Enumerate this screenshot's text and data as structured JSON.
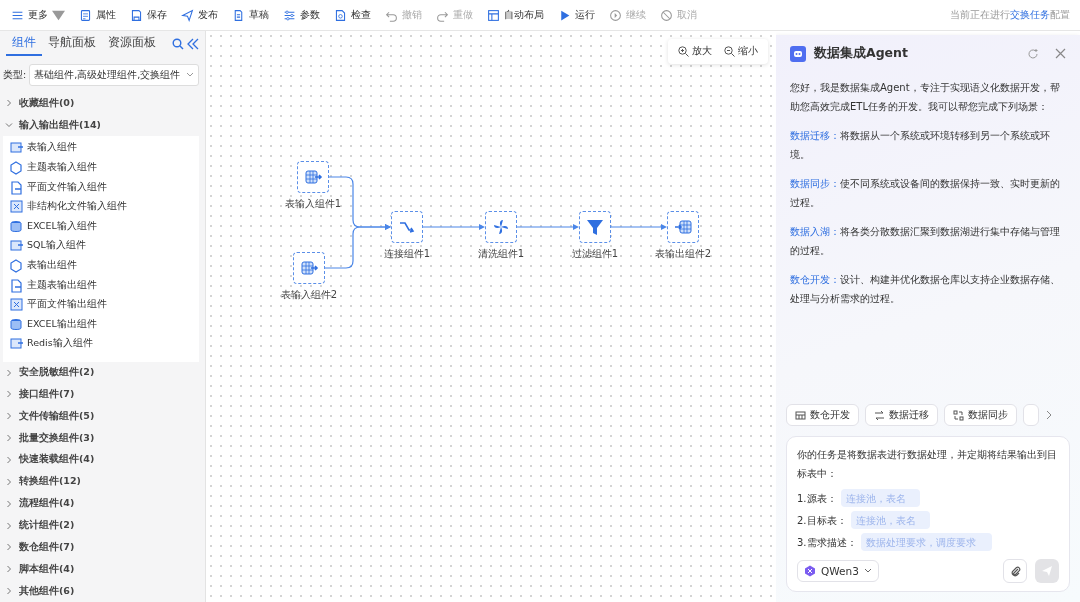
{
  "toolbar": {
    "items": [
      {
        "kind": "menu",
        "label": "更多",
        "disabled": false
      },
      {
        "kind": "button",
        "label": "属性",
        "disabled": false
      },
      {
        "kind": "button",
        "label": "保存",
        "disabled": false
      },
      {
        "kind": "button",
        "label": "发布",
        "disabled": false
      },
      {
        "kind": "button",
        "label": "草稿",
        "disabled": false
      },
      {
        "kind": "button",
        "label": "参数",
        "disabled": false
      },
      {
        "kind": "button",
        "label": "检查",
        "disabled": false
      },
      {
        "kind": "button",
        "label": "撤销",
        "disabled": true
      },
      {
        "kind": "button",
        "label": "重做",
        "disabled": true
      },
      {
        "kind": "button",
        "label": "自动布局",
        "disabled": false
      },
      {
        "kind": "button",
        "label": "运行",
        "disabled": false
      },
      {
        "kind": "button",
        "label": "继续",
        "disabled": true
      },
      {
        "kind": "button",
        "label": "取消",
        "disabled": true
      }
    ],
    "status": {
      "before": "当前正在进行",
      "link": "交换任务",
      "after": "配置"
    }
  },
  "sidebar": {
    "tabs": [
      {
        "label": "组件",
        "selected": true
      },
      {
        "label": "导航面板",
        "selected": false
      },
      {
        "label": "资源面板",
        "selected": false
      }
    ],
    "type_label": "类型:",
    "type_value": "基础组件,高级处理组件,交换组件",
    "categories": [
      {
        "label": "收藏组件(0)",
        "expanded": false
      },
      {
        "label": "输入输出组件(14)",
        "expanded": true,
        "children": [
          {
            "label": "表输入组件"
          },
          {
            "label": "主题表输入组件"
          },
          {
            "label": "平面文件输入组件"
          },
          {
            "label": "非结构化文件输入组件"
          },
          {
            "label": "EXCEL输入组件"
          },
          {
            "label": "SQL输入组件"
          },
          {
            "label": "表输出组件"
          },
          {
            "label": "主题表输出组件"
          },
          {
            "label": "平面文件输出组件"
          },
          {
            "label": "EXCEL输出组件"
          },
          {
            "label": "Redis输入组件"
          }
        ]
      },
      {
        "label": "安全脱敏组件(2)",
        "expanded": false
      },
      {
        "label": "接口组件(7)",
        "expanded": false
      },
      {
        "label": "文件传输组件(5)",
        "expanded": false
      },
      {
        "label": "批量交换组件(3)",
        "expanded": false
      },
      {
        "label": "快速装载组件(4)",
        "expanded": false
      },
      {
        "label": "转换组件(12)",
        "expanded": false
      },
      {
        "label": "流程组件(4)",
        "expanded": false
      },
      {
        "label": "统计组件(2)",
        "expanded": false
      },
      {
        "label": "数仓组件(7)",
        "expanded": false
      },
      {
        "label": "脚本组件(4)",
        "expanded": false
      },
      {
        "label": "其他组件(6)",
        "expanded": false
      }
    ]
  },
  "canvas": {
    "zoom": [
      "放大",
      "缩小"
    ],
    "nodes": [
      {
        "kind": "table-input",
        "label": "表输入组件1"
      },
      {
        "kind": "table-input",
        "label": "表输入组件2"
      },
      {
        "kind": "join",
        "label": "连接组件1"
      },
      {
        "kind": "clean",
        "label": "清洗组件1"
      },
      {
        "kind": "filter",
        "label": "过滤组件1"
      },
      {
        "kind": "table-output",
        "label": "表输出组件2"
      }
    ]
  },
  "agent": {
    "title": "数据集成Agent",
    "intro": "您好，我是数据集成Agent，专注于实现语义化数据开发，帮助您高效完成ETL任务的开发。我可以帮您完成下列场景：",
    "scenarios": [
      {
        "term": "数据迁移：",
        "text": "将数据从一个系统或环境转移到另一个系统或环境。"
      },
      {
        "term": "数据同步：",
        "text": "使不同系统或设备间的数据保持一致、实时更新的过程。"
      },
      {
        "term": "数据入湖：",
        "text": "将各类分散数据汇聚到数据湖进行集中存储与管理的过程。"
      },
      {
        "term": "数仓开发：",
        "text": "设计、构建并优化数据仓库以支持企业数据存储、处理与分析需求的过程。"
      }
    ],
    "chips": [
      {
        "label": "数仓开发"
      },
      {
        "label": "数据迁移"
      },
      {
        "label": "数据同步"
      }
    ],
    "prompt": "你的任务是将数据表进行数据处理，并定期将结果输出到目标表中：",
    "fields": [
      {
        "label": "1.源表：",
        "placeholder": "连接池，表名"
      },
      {
        "label": "2.目标表：",
        "placeholder": "连接池，表名"
      },
      {
        "label": "3.需求描述：",
        "placeholder": "数据处理要求，调度要求"
      }
    ],
    "model": "QWen3",
    "send": {
      "disabled": true
    }
  }
}
